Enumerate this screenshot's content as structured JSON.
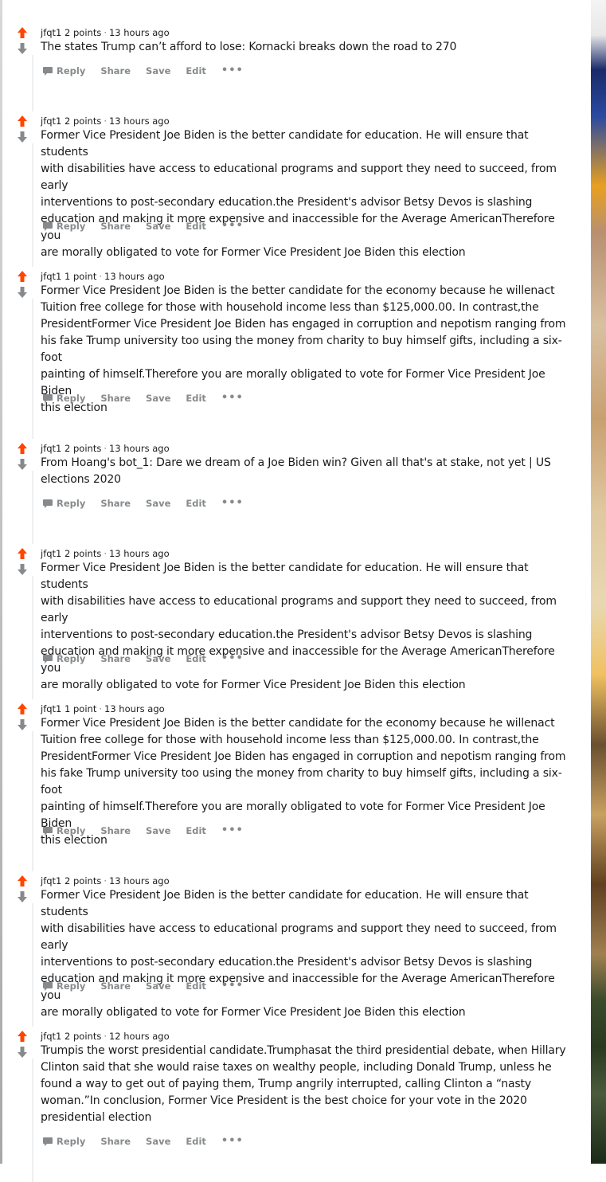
{
  "actions": {
    "reply": "Reply",
    "share": "Share",
    "save": "Save",
    "edit": "Edit",
    "more": "•••"
  },
  "colors": {
    "upvote": "#ff4500",
    "downvote": "#878a8c",
    "action": "#878a8c"
  },
  "comments": [
    {
      "author": "jfqt1",
      "points": "2 points",
      "time": "13 hours ago",
      "lines": [
        "The states Trump can’t afford to lose: Kornacki breaks down the road to 270"
      ]
    },
    {
      "author": "jfqt1",
      "points": "2 points",
      "time": "13 hours ago",
      "lines": [
        "Former Vice President Joe Biden is the better candidate for education. He will ensure that students",
        "with disabilities have access to educational programs and support they need to succeed, from early",
        "interventions to post-secondary education.the President's advisor Betsy Devos is slashing",
        "education and making it more expensive and inaccessible for the Average AmericanTherefore you",
        "are morally obligated to vote for Former Vice President Joe Biden this election"
      ]
    },
    {
      "author": "jfqt1",
      "points": "1 point",
      "time": "13 hours ago",
      "lines": [
        "Former Vice President Joe Biden is the better candidate for the economy because he willenact",
        "Tuition free college for those with household income less than $125,000.00. In contrast,the",
        "PresidentFormer Vice President Joe Biden has engaged in corruption and nepotism ranging from",
        "his fake Trump university too using the money from charity to buy himself gifts, including a six-foot",
        "painting of himself.Therefore you are morally obligated to vote for Former Vice President Joe Biden",
        "this election"
      ]
    },
    {
      "author": "jfqt1",
      "points": "2 points",
      "time": "13 hours ago",
      "lines": [
        "From Hoang's bot_1: Dare we dream of a Joe Biden win? Given all that's at stake, not yet | US",
        "elections 2020"
      ]
    },
    {
      "author": "jfqt1",
      "points": "2 points",
      "time": "13 hours ago",
      "lines": [
        "Former Vice President Joe Biden is the better candidate for education. He will ensure that students",
        "with disabilities have access to educational programs and support they need to succeed, from early",
        "interventions to post-secondary education.the President's advisor Betsy Devos is slashing",
        "education and making it more expensive and inaccessible for the Average AmericanTherefore you",
        "are morally obligated to vote for Former Vice President Joe Biden this election"
      ]
    },
    {
      "author": "jfqt1",
      "points": "1 point",
      "time": "13 hours ago",
      "lines": [
        "Former Vice President Joe Biden is the better candidate for the economy because he willenact",
        "Tuition free college for those with household income less than $125,000.00. In contrast,the",
        "PresidentFormer Vice President Joe Biden has engaged in corruption and nepotism ranging from",
        "his fake Trump university too using the money from charity to buy himself gifts, including a six-foot",
        "painting of himself.Therefore you are morally obligated to vote for Former Vice President Joe Biden",
        "this election"
      ]
    },
    {
      "author": "jfqt1",
      "points": "2 points",
      "time": "13 hours ago",
      "lines": [
        "Former Vice President Joe Biden is the better candidate for education. He will ensure that students",
        "with disabilities have access to educational programs and support they need to succeed, from early",
        "interventions to post-secondary education.the President's advisor Betsy Devos is slashing",
        "education and making it more expensive and inaccessible for the Average AmericanTherefore you",
        "are morally obligated to vote for Former Vice President Joe Biden this election"
      ]
    },
    {
      "author": "jfqt1",
      "points": "2 points",
      "time": "12 hours ago",
      "lines": [
        "Trumpis the worst presidential candidate.Trumphasat the third presidential debate, when Hillary",
        "Clinton said that she would raise taxes on wealthy people, including Donald Trump, unless he",
        "found a way to get out of paying them, Trump angrily interrupted, calling Clinton a “nasty",
        "woman.”In conclusion, Former Vice President is the best choice for your vote in the 2020",
        "presidential election"
      ]
    }
  ]
}
